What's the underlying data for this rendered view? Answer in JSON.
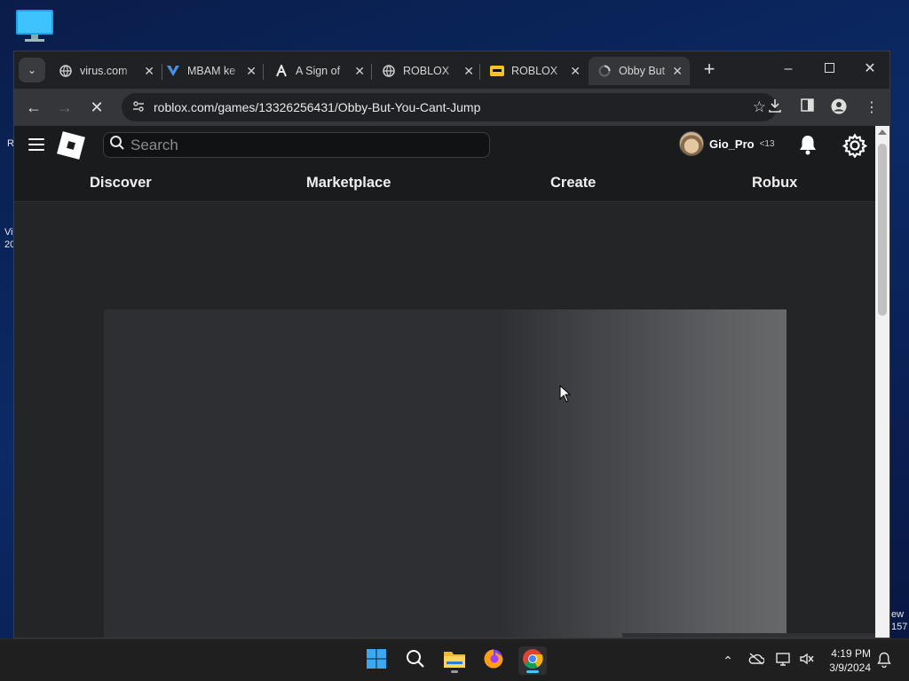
{
  "desktop": {
    "left_fragments": [
      "R",
      "Vi",
      "20"
    ],
    "right_fragments": [
      "ew",
      "157"
    ]
  },
  "browser": {
    "tabs": [
      {
        "title": "virus.com",
        "icon": "globe-icon"
      },
      {
        "title": "MBAM ke",
        "icon": "malwarebytes-icon"
      },
      {
        "title": "A Sign of",
        "icon": "site-logo-icon"
      },
      {
        "title": "ROBLOX",
        "icon": "globe-icon"
      },
      {
        "title": "ROBLOX",
        "icon": "imdb-icon"
      },
      {
        "title": "Obby But",
        "icon": "loading-icon",
        "active": true
      }
    ],
    "url": "roblox.com/games/13326256431/Obby-But-You-Cant-Jump"
  },
  "roblox": {
    "search_placeholder": "Search",
    "username": "Gio_Pro",
    "age_badge": "<13",
    "nav": [
      "Discover",
      "Marketplace",
      "Create",
      "Robux"
    ]
  },
  "taskbar": {
    "time": "4:19 PM",
    "date": "3/9/2024"
  },
  "colors": {
    "page_bg": "#232527",
    "header_bg": "#1a1b1d",
    "accent": "#4cc2ff"
  }
}
